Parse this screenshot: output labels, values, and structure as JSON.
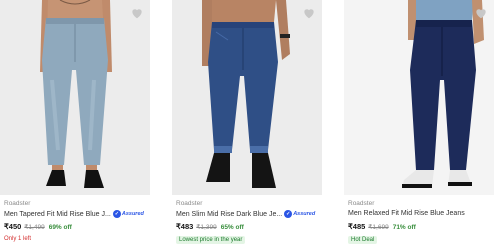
{
  "products": [
    {
      "brand": "Roadster",
      "title": "Men Tapered Fit Mid Rise Blue J...",
      "assured": "Assured",
      "price": "₹450",
      "mrp": "₹1,499",
      "discount": "69% off",
      "tag": "Only 1 left",
      "tag_style": "red"
    },
    {
      "brand": "Roadster",
      "title": "Men Slim Mid Rise Dark Blue Je...",
      "assured": "Assured",
      "price": "₹483",
      "mrp": "₹1,399",
      "discount": "65% off",
      "tag": "Lowest price in the year",
      "tag_style": "green"
    },
    {
      "brand": "Roadster",
      "title": "Men Relaxed Fit Mid Rise Blue Jeans",
      "assured": "",
      "price": "₹485",
      "mrp": "₹1,699",
      "discount": "71% off",
      "tag": "Hot Deal",
      "tag_style": "green"
    }
  ],
  "icons": {
    "wishlist": "heart-icon",
    "assured_badge": "flipkart-assured-icon"
  },
  "colors": {
    "discount": "#388e3c",
    "assured": "#2a55e5",
    "stock_warning": "#d32f2f"
  }
}
